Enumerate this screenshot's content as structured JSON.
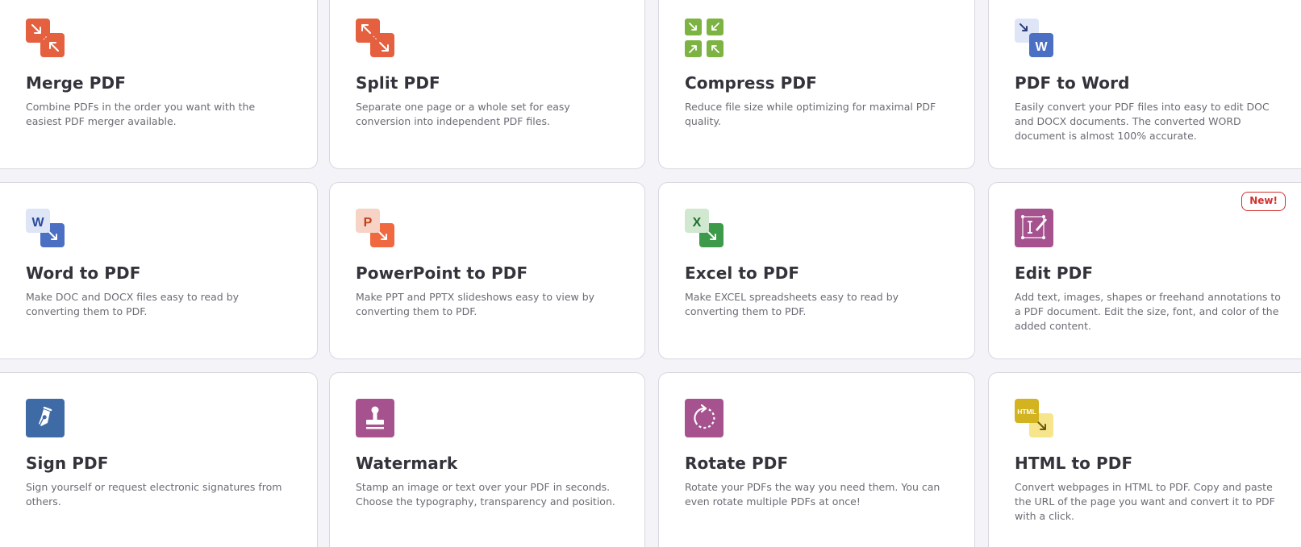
{
  "tools": [
    {
      "title": "Merge PDF",
      "description": "Combine PDFs in the order you want with the easiest PDF merger available.",
      "icon": "merge-arrows-icon",
      "color": "#e5603f"
    },
    {
      "title": "Split PDF",
      "description": "Separate one page or a whole set for easy conversion into independent PDF files.",
      "icon": "split-arrows-icon",
      "color": "#e5603f"
    },
    {
      "title": "Compress PDF",
      "description": "Reduce file size while optimizing for maximal PDF quality.",
      "icon": "compress-arrows-icon",
      "color": "#7cb342"
    },
    {
      "title": "PDF to Word",
      "description": "Easily convert your PDF files into easy to edit DOC and DOCX documents. The converted WORD document is almost 100% accurate.",
      "icon": "pdf-to-word-icon",
      "color": "#4a6fc3"
    },
    {
      "title": "Word to PDF",
      "description": "Make DOC and DOCX files easy to read by converting them to PDF.",
      "icon": "word-to-pdf-icon",
      "color": "#4a6fc3"
    },
    {
      "title": "PowerPoint to PDF",
      "description": "Make PPT and PPTX slideshows easy to view by converting them to PDF.",
      "icon": "powerpoint-to-pdf-icon",
      "color": "#f0683f"
    },
    {
      "title": "Excel to PDF",
      "description": "Make EXCEL spreadsheets easy to read by converting them to PDF.",
      "icon": "excel-to-pdf-icon",
      "color": "#3d9a4a"
    },
    {
      "title": "Edit PDF",
      "description": "Add text, images, shapes or freehand annotations to a PDF document. Edit the size, font, and color of the added content.",
      "icon": "edit-pdf-icon",
      "color": "#a5528f",
      "badge": "New!"
    },
    {
      "title": "Sign PDF",
      "description": "Sign yourself or request electronic signatures from others.",
      "icon": "pen-nib-icon",
      "color": "#3e6ba6"
    },
    {
      "title": "Watermark",
      "description": "Stamp an image or text over your PDF in seconds. Choose the typography, transparency and position.",
      "icon": "stamp-icon",
      "color": "#a5528f"
    },
    {
      "title": "Rotate PDF",
      "description": "Rotate your PDFs the way you need them. You can even rotate multiple PDFs at once!",
      "icon": "rotate-icon",
      "color": "#a5528f"
    },
    {
      "title": "HTML to PDF",
      "description": "Convert webpages in HTML to PDF. Copy and paste the URL of the page you want and convert it to PDF with a click.",
      "icon": "html-to-pdf-icon",
      "color": "#d8b61f"
    }
  ]
}
